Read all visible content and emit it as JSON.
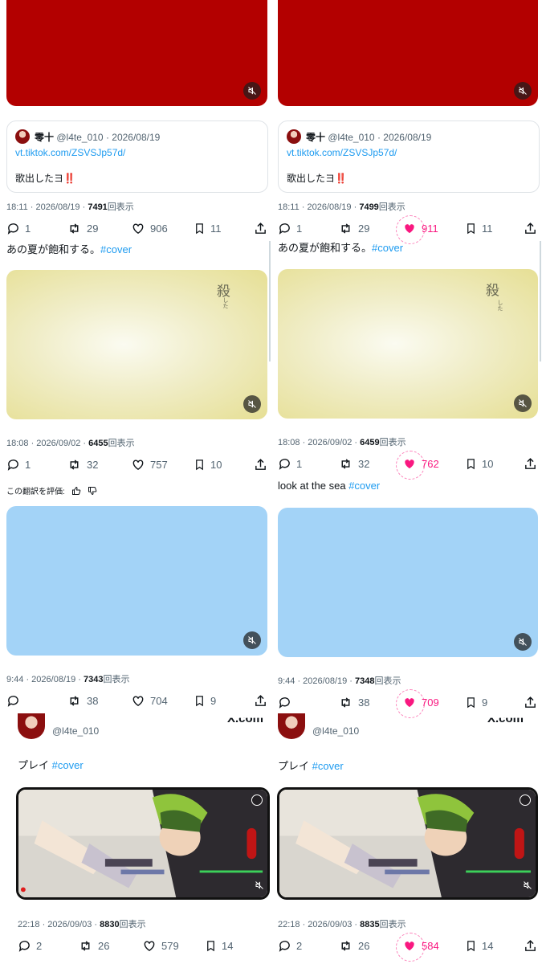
{
  "colors": {
    "red_media": "#b30000",
    "yellow_media": "#e9e39a",
    "blue_media": "#a3d3f7",
    "link": "#1d9bf0",
    "like_pink": "#f91880"
  },
  "left": {
    "quote": {
      "name": "零十",
      "handle": "@l4te_010",
      "date": "2026/08/19",
      "url": "vt.tiktok.com/ZSVSJp57d/",
      "text": "歌出したヨ‼️"
    },
    "posts": [
      {
        "time": "18:11 · 2026/08/19 · ",
        "views": "7491",
        "views_suffix": "回表示",
        "replies": "1",
        "reposts": "29",
        "likes": "906",
        "bookmarks": "11"
      },
      {
        "caption": "あの夏が飽和する。",
        "hashtag": "#cover",
        "time": "18:08 · 2026/09/02 · ",
        "views": "6455",
        "views_suffix": "回表示",
        "replies": "1",
        "reposts": "32",
        "likes": "757",
        "bookmarks": "10"
      },
      {
        "time": "9:44 · 2026/08/19 · ",
        "views": "7343",
        "views_suffix": "回表示",
        "replies": "",
        "reposts": "38",
        "likes": "704",
        "bookmarks": "9"
      },
      {
        "handle": "@l4te_010",
        "caption": "プレイ",
        "hashtag": "#cover",
        "time": "22:18 · 2026/09/03 · ",
        "views": "8830",
        "views_suffix": "回表示",
        "replies": "2",
        "reposts": "26",
        "likes": "579",
        "bookmarks": "14"
      }
    ],
    "translate_label": "この翻訳を評価:"
  },
  "right": {
    "quote": {
      "name": "零十",
      "handle": "@l4te_010",
      "date": "2026/08/19",
      "url": "vt.tiktok.com/ZSVSJp57d/",
      "text": "歌出したヨ‼️"
    },
    "posts": [
      {
        "time": "18:11 · 2026/08/19 · ",
        "views": "7499",
        "views_suffix": "回表示",
        "replies": "1",
        "reposts": "29",
        "likes": "911",
        "bookmarks": "11"
      },
      {
        "caption": "あの夏が飽和する。",
        "hashtag": "#cover",
        "time": "18:08 · 2026/09/02 · ",
        "views": "6459",
        "views_suffix": "回表示",
        "replies": "1",
        "reposts": "32",
        "likes": "762",
        "bookmarks": "10"
      },
      {
        "caption": "look at the sea",
        "hashtag": "#cover",
        "time": "9:44 · 2026/08/19 · ",
        "views": "7348",
        "views_suffix": "回表示",
        "replies": "",
        "reposts": "38",
        "likes": "709",
        "bookmarks": "9"
      },
      {
        "handle": "@l4te_010",
        "caption": "プレイ",
        "hashtag": "#cover",
        "time": "22:18 · 2026/09/03 · ",
        "views": "8835",
        "views_suffix": "回表示",
        "replies": "2",
        "reposts": "26",
        "likes": "584",
        "bookmarks": "14"
      }
    ]
  },
  "overlay": {
    "image_text": "殺",
    "image_text_small": "した",
    "watermark": "X.com"
  }
}
